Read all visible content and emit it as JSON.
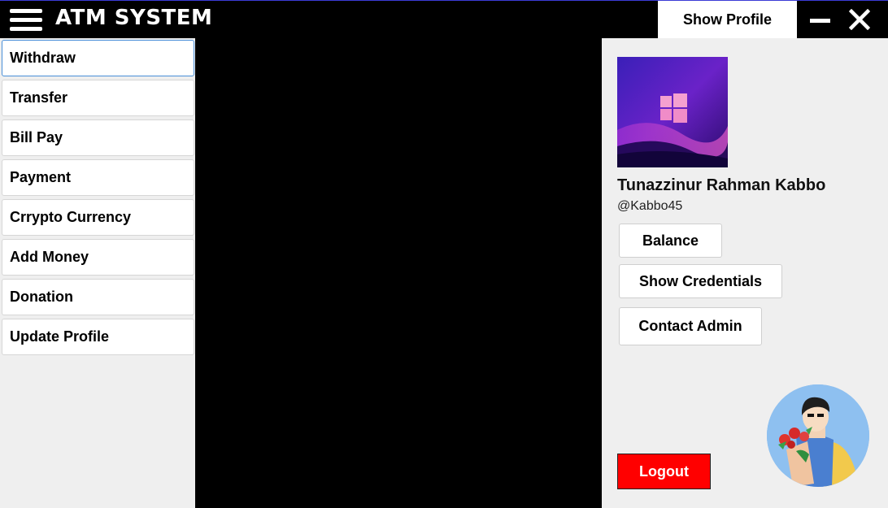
{
  "window": {
    "title": "ATM SYSTEM",
    "show_profile_label": "Show Profile"
  },
  "sidebar": {
    "items": [
      {
        "label": "Withdraw"
      },
      {
        "label": "Transfer"
      },
      {
        "label": "Bill Pay"
      },
      {
        "label": "Payment"
      },
      {
        "label": "Crrypto Currency"
      },
      {
        "label": "Add Money"
      },
      {
        "label": "Donation"
      },
      {
        "label": "Update Profile"
      }
    ],
    "active_item": "Withdraw"
  },
  "profile": {
    "name": "Tunazzinur Rahman Kabbo",
    "handle": "@Kabbo45",
    "buttons": {
      "balance": "Balance",
      "show_credentials": "Show Credentials",
      "contact_admin": "Contact Admin"
    },
    "logout_label": "Logout"
  },
  "colors": {
    "titlebar_bg": "#000000",
    "panel_bg": "#efefef",
    "logout_bg": "#ff0000",
    "active_border": "#4a8fd8"
  },
  "icons": {
    "menu": "hamburger-icon",
    "minimize": "minimize-icon",
    "close": "close-icon",
    "profile_picture": "windows-logo-wallpaper",
    "avatar": "user-avatar-with-flowers"
  }
}
